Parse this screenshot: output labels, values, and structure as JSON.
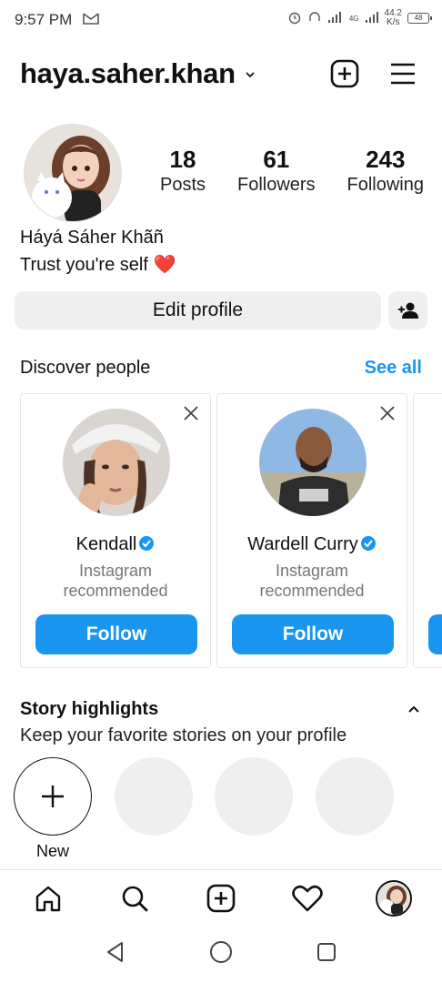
{
  "status_bar": {
    "time": "9:57 PM",
    "network": "4G",
    "speed_value": "44.2",
    "speed_unit": "K/s",
    "battery": "48"
  },
  "header": {
    "username": "haya.saher.khan"
  },
  "profile": {
    "stats": [
      {
        "value": "18",
        "label": "Posts"
      },
      {
        "value": "61",
        "label": "Followers"
      },
      {
        "value": "243",
        "label": "Following"
      }
    ],
    "display_name": "Háyá Sáher Khãñ",
    "bio_text": "Trust you're self",
    "bio_emoji": "❤️",
    "edit_label": "Edit profile"
  },
  "discover": {
    "title": "Discover people",
    "see_all": "See all",
    "cards": [
      {
        "name": "Kendall",
        "sub_line1": "Instagram",
        "sub_line2": "recommended",
        "button": "Follow"
      },
      {
        "name": "Wardell Curry",
        "sub_line1": "Instagram",
        "sub_line2": "recommended",
        "button": "Follow"
      }
    ]
  },
  "highlights": {
    "title": "Story highlights",
    "subtitle": "Keep your favorite stories on your profile",
    "new_label": "New"
  },
  "colors": {
    "accent": "#1a96f0",
    "button_bg": "#efefef",
    "heart": "#e0201c"
  },
  "icons": {
    "header": [
      "chevron-down-icon",
      "create-plus-icon",
      "menu-hamburger-icon"
    ],
    "bottom_nav": [
      "home-icon",
      "search-icon",
      "create-icon",
      "heart-icon",
      "profile-avatar"
    ],
    "system_nav": [
      "back-icon",
      "home-circle-icon",
      "recents-icon"
    ]
  }
}
